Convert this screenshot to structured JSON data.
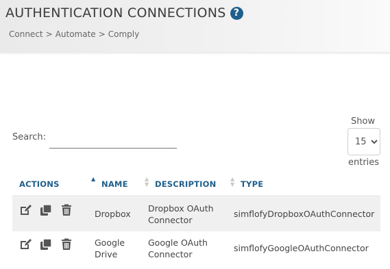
{
  "header": {
    "title": "AUTHENTICATION CONNECTIONS",
    "help_icon": "question-circle-icon",
    "breadcrumbs": [
      "Connect",
      "Automate",
      "Comply"
    ],
    "breadcrumb_separator": ">"
  },
  "search": {
    "label": "Search:",
    "value": "",
    "placeholder": ""
  },
  "length": {
    "show_label": "Show",
    "selected": "15",
    "entries_label": "entries"
  },
  "table": {
    "columns": [
      "ACTIONS",
      "NAME",
      "DESCRIPTION",
      "TYPE"
    ],
    "sorted_column": "NAME",
    "sort_direction": "ascending",
    "rows": [
      {
        "actions": [
          "edit-icon",
          "copy-icon",
          "trash-icon"
        ],
        "name_line1": "Dropbox",
        "name_line2": "",
        "description_line1": "Dropbox OAuth",
        "description_line2": "Connector",
        "type": "simflofyDropboxOAuthConnector"
      },
      {
        "actions": [
          "edit-icon",
          "copy-icon",
          "trash-icon"
        ],
        "name_line1": "Google",
        "name_line2": "Drive",
        "description_line1": "Google OAuth",
        "description_line2": "Connector",
        "type": "simflofyGoogleOAuthConnector"
      }
    ]
  },
  "colors": {
    "accent": "#1f5f8b",
    "row_stripe": "#f0f0f0",
    "header_bg": "#eaeaea"
  }
}
